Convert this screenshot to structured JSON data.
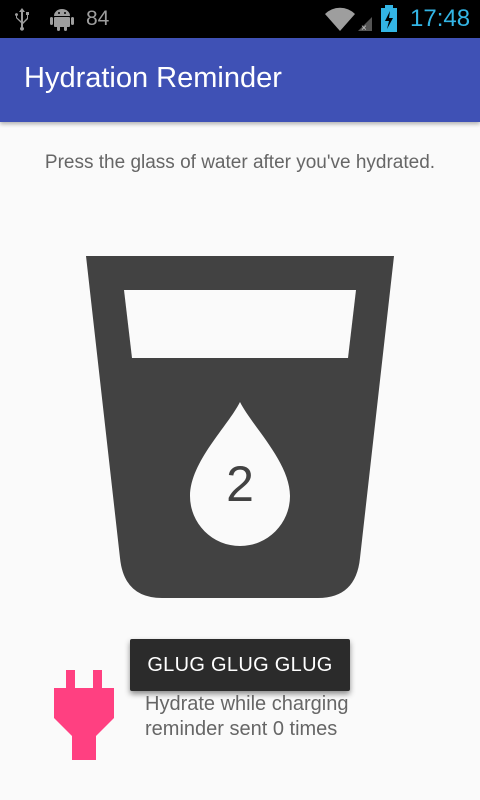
{
  "status_bar": {
    "notification_count": "84",
    "time": "17:48",
    "icons": [
      "usb-icon",
      "android-debug-icon",
      "wifi-icon",
      "signal-icon",
      "battery-charging-icon"
    ]
  },
  "app_bar": {
    "title": "Hydration Reminder"
  },
  "main": {
    "instruction": "Press the glass of water after you've hydrated.",
    "water_count": "2",
    "glass_icon": "water-glass-icon",
    "glug_button": "GLUG GLUG GLUG",
    "charging": {
      "icon": "power-plug-icon",
      "line1": "Hydrate while charging",
      "line2": "reminder sent 0 times"
    }
  },
  "colors": {
    "primary": "#3f51b5",
    "glass": "#424242",
    "plug": "#ff4081",
    "clock": "#33b5e5"
  }
}
